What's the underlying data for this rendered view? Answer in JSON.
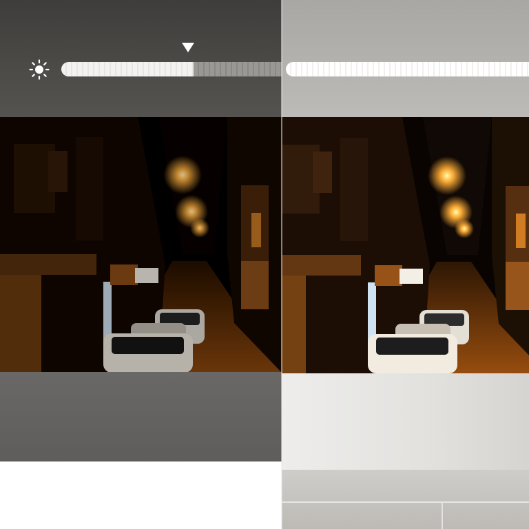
{
  "brightness_control": {
    "icon": "sun-icon",
    "level_fraction": 0.6
  },
  "photo": {
    "subject": "night-street-scene",
    "icon": "street-photo"
  },
  "colors": {
    "lamp_glow": "#ffb347",
    "left_wall": "#5a5855",
    "right_wall": "#d8d6d3",
    "slider_fill": "#f3f2f0"
  }
}
